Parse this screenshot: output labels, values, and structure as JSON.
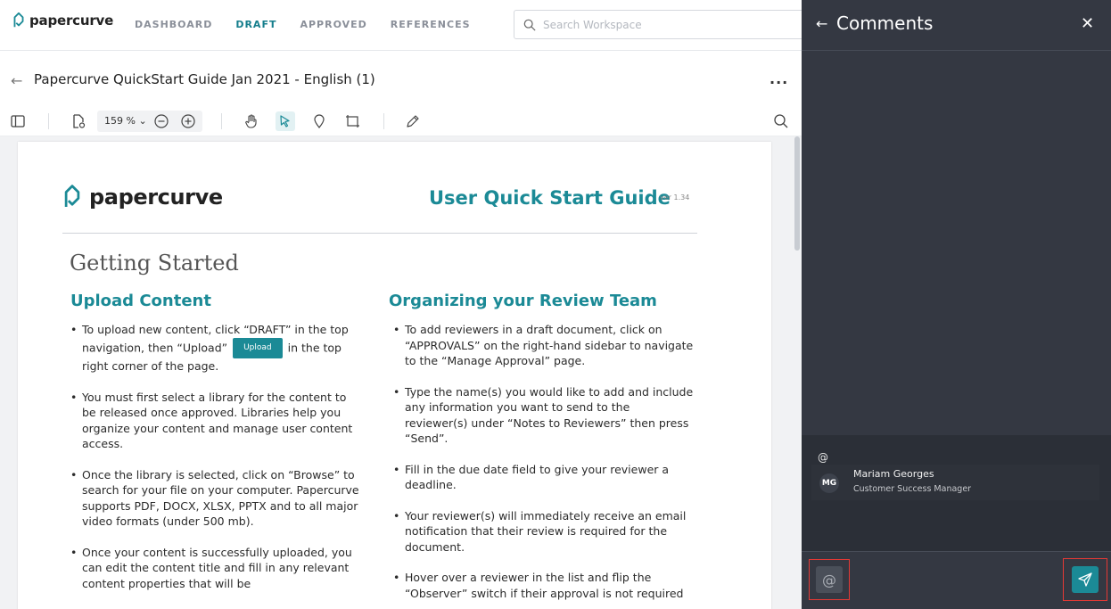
{
  "app": {
    "logo_text": "papercurve"
  },
  "nav": {
    "items": [
      "DASHBOARD",
      "DRAFT",
      "APPROVED",
      "REFERENCES"
    ],
    "active": "DRAFT"
  },
  "search": {
    "placeholder": "Search Workspace"
  },
  "doc": {
    "title": "Papercurve QuickStart Guide Jan 2021 - English (1)",
    "more": "..."
  },
  "toolbar": {
    "zoom": "159 %"
  },
  "page": {
    "logo_text": "papercurve",
    "guide_title": "User Quick Start Guide",
    "version": "ver 1.34",
    "heading": "Getting Started",
    "left_col": {
      "heading": "Upload Content",
      "b1_pre": "To upload new content, click “DRAFT” in the top navigation, then “Upload”",
      "b1_chip": "Upload",
      "b1_post": "in the top right corner of the page.",
      "bullets": [
        "You must first select a library for the content to be released once approved. Libraries help you organize your content and manage user content access.",
        "Once the library is selected, click on “Browse” to search for your file on your computer. Papercurve supports PDF, DOCX, XLSX, PPTX and to all major video formats  (under 500 mb).",
        "Once your content is successfully uploaded, you can edit the content title and fill in any relevant content properties that will be"
      ]
    },
    "right_col": {
      "heading": "Organizing your Review Team",
      "bullets": [
        "To add reviewers in a draft document, click on “APPROVALS” on the right-hand sidebar to navigate to the “Manage Approval” page.",
        "Type the name(s) you would like to add and include any information you want to send to the reviewer(s) under “Notes to Reviewers” then press “Send”.",
        "Fill in the due date field to give your reviewer a deadline.",
        "Your reviewer(s) will immediately receive an email notification that their review is required for the document.",
        "Hover over a reviewer in the list and flip the “Observer” switch if their approval is not required"
      ]
    }
  },
  "comments": {
    "title": "Comments",
    "mention_query": "@",
    "suggestion": {
      "initials": "MG",
      "name": "Mariam Georges",
      "role": "Customer Success Manager"
    },
    "at_button": "@"
  },
  "colors": {
    "accent": "#1b8a96",
    "panel_bg": "#343842",
    "highlight": "#e53935"
  }
}
